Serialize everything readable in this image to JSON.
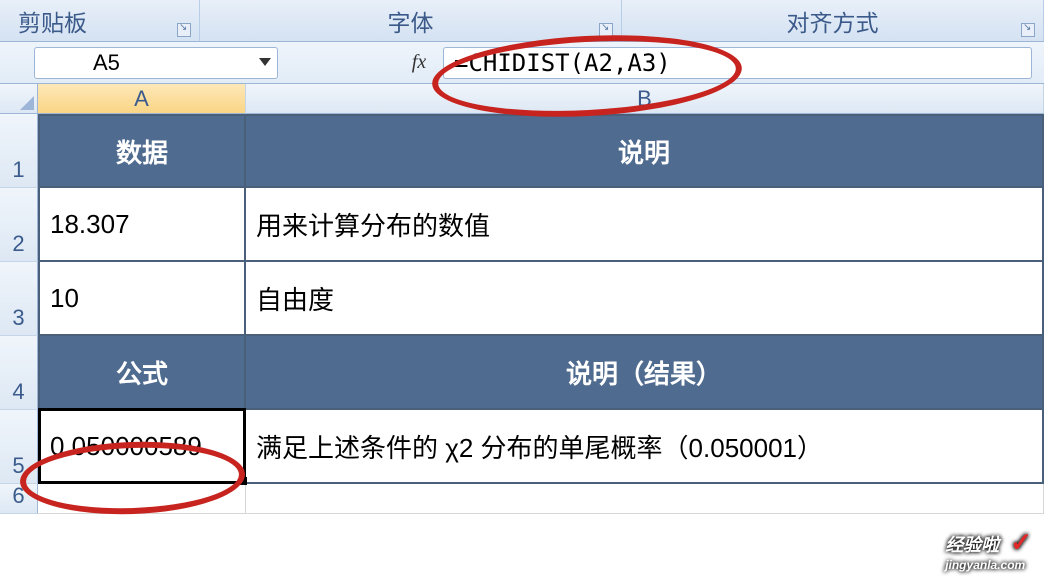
{
  "ribbon": {
    "groups": [
      "剪贴板",
      "字体",
      "对齐方式"
    ]
  },
  "nameBox": "A5",
  "fxLabel": "fx",
  "formula": "=CHIDIST(A2,A3)",
  "columns": [
    "A",
    "B"
  ],
  "rowNumbers": [
    "1",
    "2",
    "3",
    "4",
    "5",
    "6"
  ],
  "sheet": {
    "r1": {
      "A": "数据",
      "B": "说明"
    },
    "r2": {
      "A": "18.307",
      "B": "用来计算分布的数值"
    },
    "r3": {
      "A": "10",
      "B": "自由度"
    },
    "r4": {
      "A": "公式",
      "B": "说明（结果）"
    },
    "r5": {
      "A": "0.050000589",
      "B": "满足上述条件的 χ2 分布的单尾概率（0.050001）"
    }
  },
  "colors": {
    "headerFill": "#4f6b8f",
    "annotate": "#c8241f"
  },
  "watermark": {
    "brand": "经验啦",
    "url": "jingyanla.com",
    "check": "✓"
  }
}
